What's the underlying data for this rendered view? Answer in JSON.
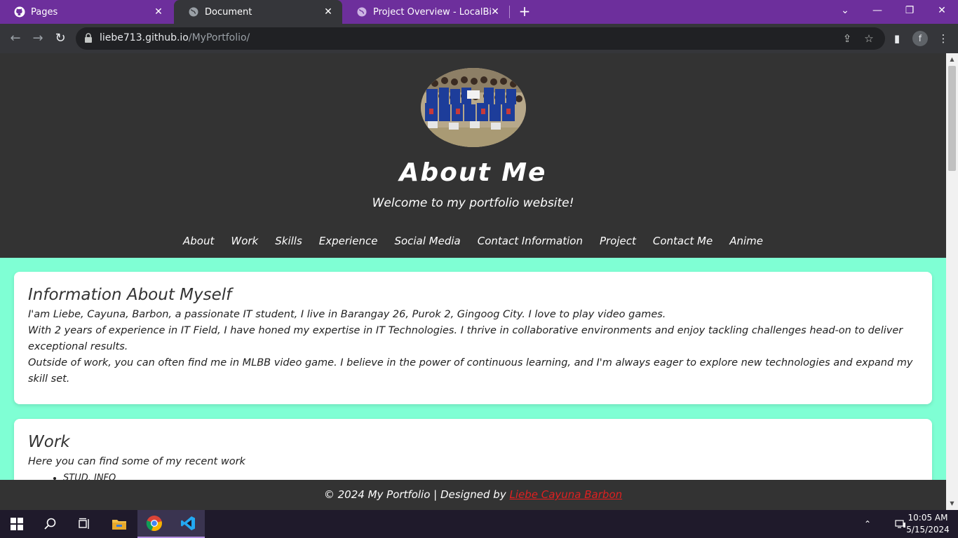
{
  "browser": {
    "tabs": [
      {
        "title": "Pages",
        "icon": "github-icon"
      },
      {
        "title": "Document",
        "icon": "globe-icon"
      },
      {
        "title": "Project Overview - LocalBizWeb",
        "icon": "globe-icon"
      }
    ],
    "url_host": "liebe713.github.io",
    "url_path": "/MyPortfolio/",
    "profile_initial": "f"
  },
  "header": {
    "title": "About Me",
    "subtitle": "Welcome to my portfolio website!",
    "nav": [
      "About",
      "Work",
      "Skills",
      "Experience",
      "Social Media",
      "Contact Information",
      "Project",
      "Contact Me",
      "Anime"
    ]
  },
  "about": {
    "heading": "Information About Myself",
    "lines": [
      "I'am Liebe, Cayuna, Barbon, a passionate IT student, I live in Barangay 26, Purok 2, Gingoog City. I love to play video games.",
      "With 2 years of experience in IT Field, I have honed my expertise in IT Technologies. I thrive in collaborative environments and enjoy tackling challenges head-on to deliver exceptional results.",
      "Outside of work, you can often find me in MLBB video game. I believe in the power of continuous learning, and I'm always eager to explore new technologies and expand my skill set."
    ]
  },
  "work": {
    "heading": "Work",
    "intro": "Here you can find some of my recent work",
    "items": [
      "STUD. INFO"
    ]
  },
  "footer": {
    "text": "© 2024 My Portfolio | Designed by",
    "author": "Liebe Cayuna Barbon"
  },
  "taskbar": {
    "time": "10:05 AM",
    "date": "5/15/2024"
  },
  "colors": {
    "tabbar": "#6d2f9c",
    "page_bg": "#7fffd4",
    "header_bg": "#333333",
    "footer_link": "#e02020"
  }
}
